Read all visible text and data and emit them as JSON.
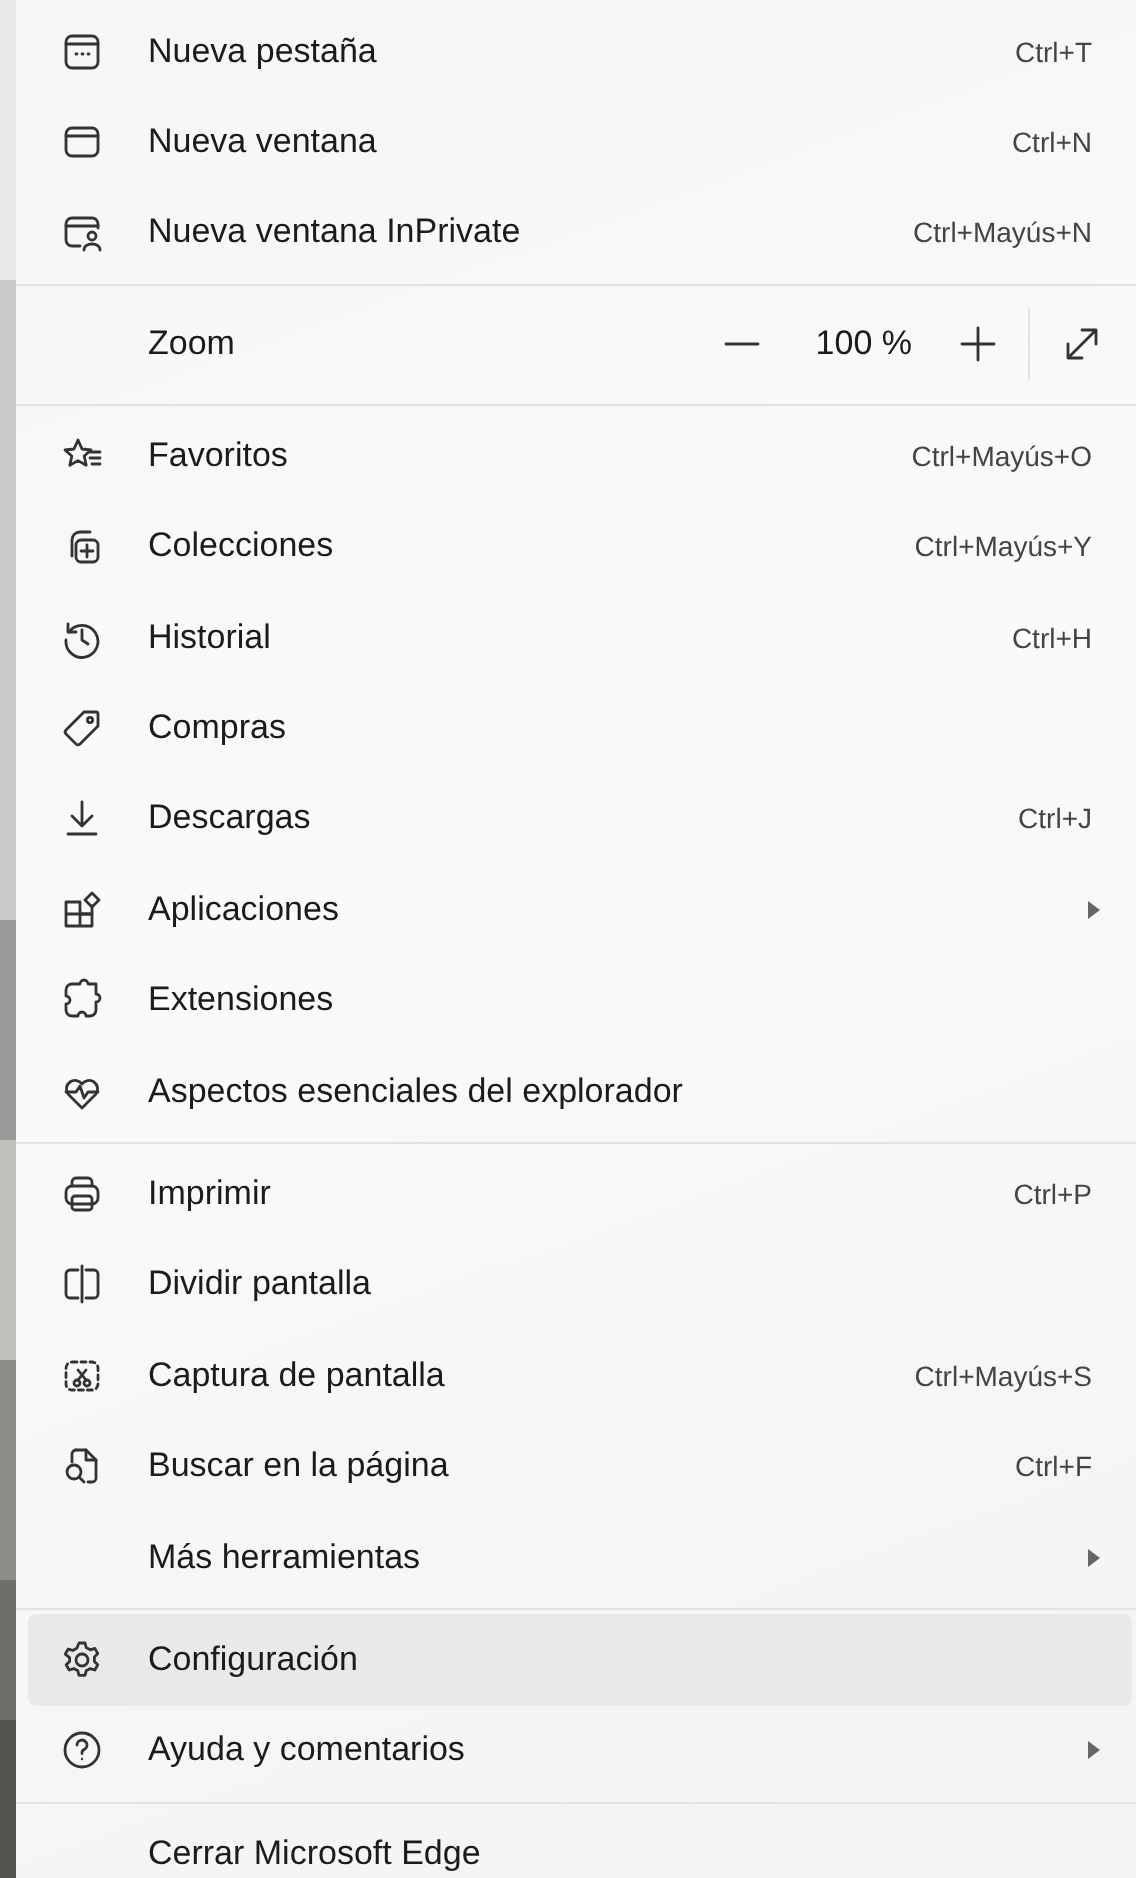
{
  "menu": [
    {
      "kind": "item",
      "label": "Nueva pestaña",
      "shortcut": "Ctrl+T",
      "submenu": false,
      "selected": false
    },
    {
      "kind": "item",
      "label": "Nueva ventana",
      "shortcut": "Ctrl+N",
      "submenu": false,
      "selected": false
    },
    {
      "kind": "item",
      "label": "Nueva ventana InPrivate",
      "shortcut": "Ctrl+Mayús+N",
      "submenu": false,
      "selected": false
    },
    {
      "kind": "separator"
    },
    {
      "kind": "zoom",
      "label": "Zoom",
      "value": "100 %"
    },
    {
      "kind": "separator"
    },
    {
      "kind": "item",
      "label": "Favoritos",
      "shortcut": "Ctrl+Mayús+O",
      "submenu": false,
      "selected": false
    },
    {
      "kind": "item",
      "label": "Colecciones",
      "shortcut": "Ctrl+Mayús+Y",
      "submenu": false,
      "selected": false
    },
    {
      "kind": "item",
      "label": "Historial",
      "shortcut": "Ctrl+H",
      "submenu": false,
      "selected": false
    },
    {
      "kind": "item",
      "label": "Compras",
      "submenu": false,
      "selected": false
    },
    {
      "kind": "item",
      "label": "Descargas",
      "shortcut": "Ctrl+J",
      "submenu": false,
      "selected": false
    },
    {
      "kind": "item",
      "label": "Aplicaciones",
      "submenu": true,
      "selected": false
    },
    {
      "kind": "item",
      "label": "Extensiones",
      "submenu": false,
      "selected": false
    },
    {
      "kind": "item",
      "label": "Aspectos esenciales del explorador",
      "submenu": false,
      "selected": false
    },
    {
      "kind": "separator"
    },
    {
      "kind": "item",
      "label": "Imprimir",
      "shortcut": "Ctrl+P",
      "submenu": false,
      "selected": false
    },
    {
      "kind": "item",
      "label": "Dividir pantalla",
      "submenu": false,
      "selected": false
    },
    {
      "kind": "item",
      "label": "Captura de pantalla",
      "shortcut": "Ctrl+Mayús+S",
      "submenu": false,
      "selected": false
    },
    {
      "kind": "item",
      "label": "Buscar en la página",
      "shortcut": "Ctrl+F",
      "submenu": false,
      "selected": false
    },
    {
      "kind": "item",
      "label": "Más herramientas",
      "submenu": true,
      "selected": false
    },
    {
      "kind": "separator"
    },
    {
      "kind": "item",
      "label": "Configuración",
      "submenu": false,
      "selected": true
    },
    {
      "kind": "item",
      "label": "Ayuda y comentarios",
      "submenu": true,
      "selected": false
    },
    {
      "kind": "separator"
    },
    {
      "kind": "item",
      "label": "Cerrar Microsoft Edge",
      "submenu": false,
      "selected": false
    }
  ]
}
